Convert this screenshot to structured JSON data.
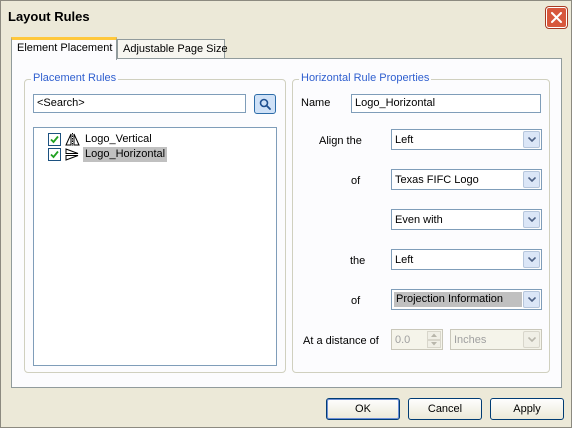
{
  "window": {
    "title": "Layout Rules",
    "close_icon": "close-icon"
  },
  "tabs": [
    {
      "label": "Element Placement",
      "active": true
    },
    {
      "label": "Adjustable Page Size",
      "active": false
    }
  ],
  "placement_rules": {
    "legend": "Placement Rules",
    "search": {
      "value": "<Search>"
    },
    "items": [
      {
        "label": "Logo_Vertical",
        "checked": true,
        "icon": "vertical-rule-icon",
        "selected": false
      },
      {
        "label": "Logo_Horizontal",
        "checked": true,
        "icon": "horizontal-rule-icon",
        "selected": true
      }
    ]
  },
  "properties": {
    "legend": "Horizontal Rule Properties",
    "name_label": "Name",
    "name_value": "Logo_Horizontal",
    "align_label": "Align the",
    "align_value": "Left",
    "of_label": "of",
    "of_value": "Texas FIFC Logo",
    "relation_value": "Even with",
    "the_label": "the",
    "the_value": "Left",
    "of2_label": "of",
    "of2_value": "Projection Information",
    "distance_label": "At a distance of",
    "distance_value": "0.0",
    "units_value": "Inches"
  },
  "buttons": {
    "ok": "OK",
    "cancel": "Cancel",
    "apply": "Apply"
  },
  "colors": {
    "accent": "#2f5fcf",
    "tab_highlight": "#ffc83c",
    "close": "#d7573c"
  }
}
